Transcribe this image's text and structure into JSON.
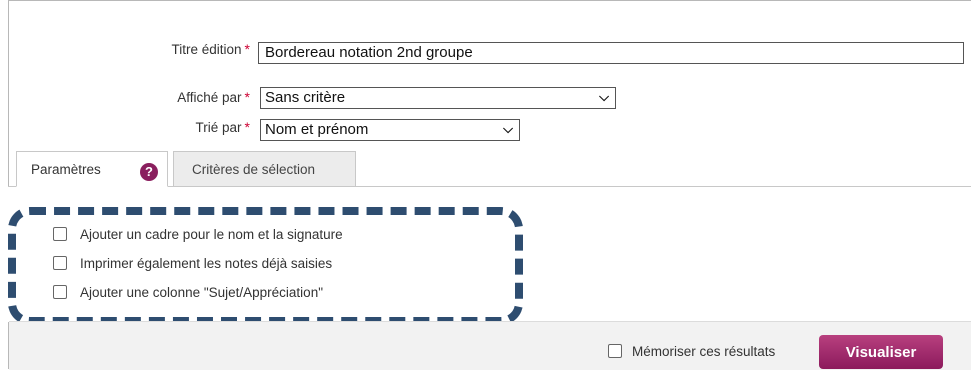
{
  "form": {
    "title_label": "Titre édition",
    "title_value": "Bordereau notation 2nd groupe",
    "displayed_by_label": "Affiché par",
    "displayed_by_value": "Sans critère",
    "sorted_by_label": "Trié par",
    "sorted_by_value": "Nom et prénom",
    "required_marker": "*"
  },
  "tabs": [
    {
      "label": "Paramètres",
      "active": true
    },
    {
      "label": "Critères de sélection",
      "active": false
    }
  ],
  "help_icon": {
    "name": "help-icon",
    "glyph": "?",
    "color": "#8a1f5e"
  },
  "options": [
    {
      "label": "Ajouter un cadre pour le nom et la signature",
      "checked": false
    },
    {
      "label": "Imprimer également les notes déjà saisies",
      "checked": false
    },
    {
      "label": "Ajouter une colonne \"Sujet/Appréciation\"",
      "checked": false
    }
  ],
  "footer": {
    "remember_label": "Mémoriser ces résultats",
    "remember_checked": false,
    "visualize_label": "Visualiser"
  },
  "colors": {
    "accent": "#8c1a5c",
    "dash": "#2e4d70",
    "required": "#cc0033"
  }
}
